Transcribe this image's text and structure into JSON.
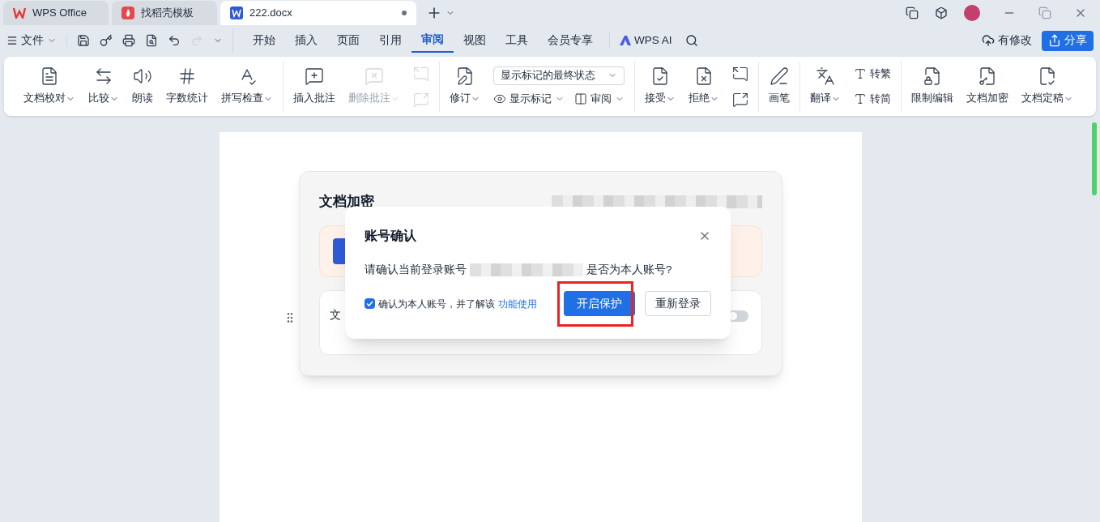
{
  "tabs": [
    {
      "label": "WPS Office",
      "kind": "home",
      "selected": false
    },
    {
      "label": "找稻壳模板",
      "kind": "template",
      "selected": false
    },
    {
      "label": "222.docx",
      "kind": "doc",
      "selected": true
    }
  ],
  "menu": {
    "file": "文件",
    "items": [
      {
        "label": "开始",
        "selected": false
      },
      {
        "label": "插入",
        "selected": false
      },
      {
        "label": "页面",
        "selected": false
      },
      {
        "label": "引用",
        "selected": false
      },
      {
        "label": "审阅",
        "selected": true
      },
      {
        "label": "视图",
        "selected": false
      },
      {
        "label": "工具",
        "selected": false
      },
      {
        "label": "会员专享",
        "selected": false
      }
    ],
    "ai": "WPS AI",
    "modified": "有修改",
    "share": "分享"
  },
  "ribbon": [
    [
      {
        "kind": "big",
        "label": "文档校对",
        "dropdown": true,
        "disabled": false
      },
      {
        "kind": "big",
        "label": "比较",
        "dropdown": true,
        "disabled": false
      },
      {
        "kind": "big",
        "label": "朗读",
        "dropdown": false,
        "disabled": false
      },
      {
        "kind": "big",
        "label": "字数统计",
        "dropdown": false,
        "disabled": false
      },
      {
        "kind": "big",
        "label": "拼写检查",
        "dropdown": true,
        "disabled": false
      }
    ],
    [
      {
        "kind": "big",
        "label": "插入批注",
        "dropdown": false,
        "disabled": false
      },
      {
        "kind": "big",
        "label": "删除批注",
        "dropdown": true,
        "disabled": true
      },
      {
        "kind": "pair",
        "disabled": true
      }
    ],
    [
      {
        "kind": "big",
        "label": "修订",
        "dropdown": true,
        "disabled": false
      },
      {
        "kind": "select",
        "value": "显示标记的最终状态",
        "below": [
          "显示标记",
          "审阅"
        ]
      }
    ],
    [
      {
        "kind": "big",
        "label": "接受",
        "dropdown": true,
        "disabled": false
      },
      {
        "kind": "big",
        "label": "拒绝",
        "dropdown": true,
        "disabled": false
      },
      {
        "kind": "pair",
        "disabled": false
      }
    ],
    [
      {
        "kind": "big",
        "label": "画笔",
        "dropdown": false,
        "disabled": false
      }
    ],
    [
      {
        "kind": "big",
        "label": "翻译",
        "dropdown": true,
        "disabled": false
      },
      {
        "kind": "stack",
        "items": [
          "转繁",
          "转简"
        ]
      }
    ],
    [
      {
        "kind": "big",
        "label": "限制编辑",
        "dropdown": false,
        "disabled": false
      },
      {
        "kind": "big",
        "label": "文档加密",
        "dropdown": false,
        "disabled": false
      },
      {
        "kind": "big",
        "label": "文档定稿",
        "dropdown": true,
        "disabled": false
      }
    ]
  ],
  "encrypt_panel": {
    "title": "文档加密",
    "option_label": "文",
    "option_on": false
  },
  "dialog": {
    "title": "账号确认",
    "message_before": "请确认当前登录账号",
    "message_after": "是否为本人账号?",
    "confirm": {
      "checked": true,
      "label": "确认为本人账号，并了解该",
      "link": "功能使用"
    },
    "primary": "开启保护",
    "secondary": "重新登录"
  }
}
